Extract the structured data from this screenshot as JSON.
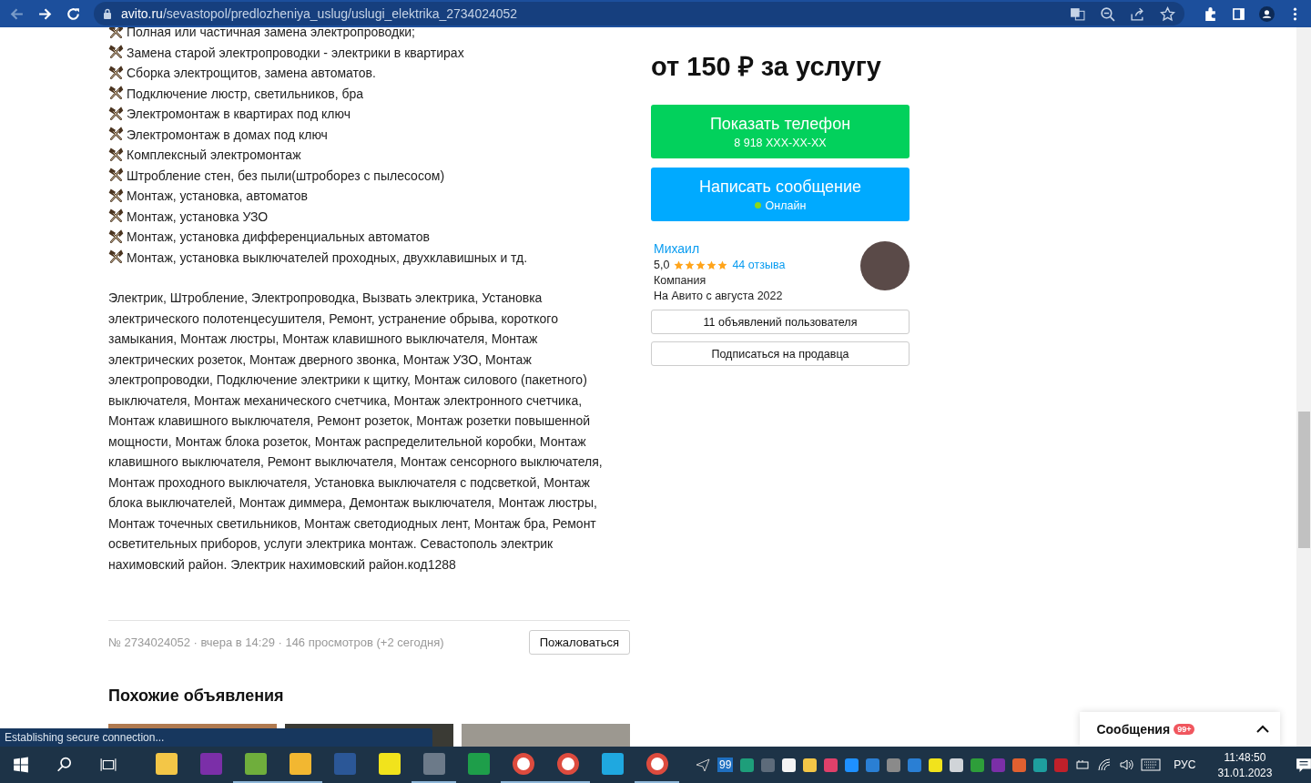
{
  "browser": {
    "url_host": "avito.ru",
    "url_path": "/sevastopol/predlozheniya_uslug/uslugi_elektrika_2734024052",
    "status": "Establishing secure connection..."
  },
  "description": {
    "items": [
      "Полная или частичная замена электропроводки;",
      "Замена старой электропроводки - электрики в квартирах",
      "Сборка электрощитов, замена автоматов.",
      "Подключение люстр, светильников, бра",
      "Электромонтаж в квартирах под ключ",
      "Электромонтаж в домах под ключ",
      "Комплексный электромонтаж",
      "Штробление стен, без пыли(штроборез с пылесосом)",
      "Монтаж, установка, автоматов",
      "Монтаж, установка УЗО",
      "Монтаж, установка дифференциальных автоматов",
      "Монтаж, установка выключателей проходных, двухклавишных и тд."
    ],
    "paragraph": "Электрик, Штробление, Электропроводка, Вызвать электрика, Установка электрического полотенцесушителя, Ремонт, устранение обрыва, короткого замыкания, Монтаж люстры, Монтаж клавишного выключателя, Монтаж электрических розеток, Монтаж дверного звонка, Монтаж УЗО, Монтаж электропроводки, Подключение электрики к щитку, Монтаж силового (пакетного) выключателя, Монтаж механического счетчика, Монтаж электронного счетчика, Монтаж клавишного выключателя, Ремонт розеток, Монтаж розетки повышенной мощности, Монтаж блока розеток, Монтаж распределительной коробки, Монтаж клавишного выключателя, Ремонт выключателя, Монтаж сенсорного выключателя, Монтаж проходного выключателя, Установка выключателя с подсветкой, Монтаж блока выключателей, Монтаж диммера, Демонтаж выключателя, Монтаж люстры, Монтаж точечных светильников, Монтаж светодиодных лент, Монтаж бра, Ремонт осветительных приборов, услуги электрика монтаж. Севастополь электрик нахимовский район. Электрик нахимовский район.код1288"
  },
  "meta": {
    "text": "№ 2734024052 · вчера в 14:29 · 146 просмотров (+2 сегодня)",
    "report": "Пожаловаться"
  },
  "similar": {
    "title": "Похожие объявления"
  },
  "price": "от 150 ₽ за услугу",
  "phone_button": {
    "label": "Показать телефон",
    "number": "8 918 XXX-XX-XX"
  },
  "message_button": {
    "label": "Написать сообщение",
    "status": "Онлайн",
    "online": true
  },
  "seller": {
    "name": "Михаил",
    "rating": "5,0",
    "stars": 5,
    "reviews": "44 отзыва",
    "type": "Компания",
    "since": "На Авито с августа 2022"
  },
  "seller_buttons": [
    "11 объявлений пользователя",
    "Подписаться на продавца"
  ],
  "messages_widget": {
    "label": "Сообщения",
    "badge": "99+"
  },
  "taskbar": {
    "apps": [
      {
        "kind": "tile",
        "color": "#f3c647",
        "running": false
      },
      {
        "kind": "tile",
        "color": "#7b2fa8",
        "running": false
      },
      {
        "kind": "tile",
        "color": "#6fae3c",
        "running": true
      },
      {
        "kind": "tile",
        "color": "#f2b731",
        "running": true
      },
      {
        "kind": "tile",
        "color": "#2b5797",
        "running": false
      },
      {
        "kind": "tile",
        "color": "#f1e31c",
        "running": false
      },
      {
        "kind": "tile",
        "color": "#6c7a89",
        "running": true
      },
      {
        "kind": "tile",
        "color": "#1e9e4a",
        "running": false
      },
      {
        "kind": "circle",
        "color": "#dd4b3e",
        "running": true
      },
      {
        "kind": "circle",
        "color": "#dd4b3e",
        "running": true
      },
      {
        "kind": "tile",
        "color": "#1fa8e0",
        "running": false
      },
      {
        "kind": "circle",
        "color": "#dd4b3e",
        "running": true
      }
    ],
    "tray_badge": "99",
    "tray": [
      {
        "color": "#1e9e7a"
      },
      {
        "color": "#5d6b7a"
      },
      {
        "color": "#f4f4f4"
      },
      {
        "color": "#f3c647"
      },
      {
        "color": "#e0406a"
      },
      {
        "color": "#1e90ff"
      },
      {
        "color": "#2a7fd4"
      },
      {
        "color": "#8a8a8a"
      },
      {
        "color": "#2a7fd4"
      },
      {
        "color": "#f1e31c"
      },
      {
        "color": "#d0d4d8"
      },
      {
        "color": "#2e9e3a"
      },
      {
        "color": "#7b2fa8"
      },
      {
        "color": "#e06030"
      },
      {
        "color": "#1e9e9e"
      },
      {
        "color": "#c0202a"
      }
    ],
    "language": "РУС",
    "time": "11:48:50",
    "date": "31.01.2023"
  }
}
